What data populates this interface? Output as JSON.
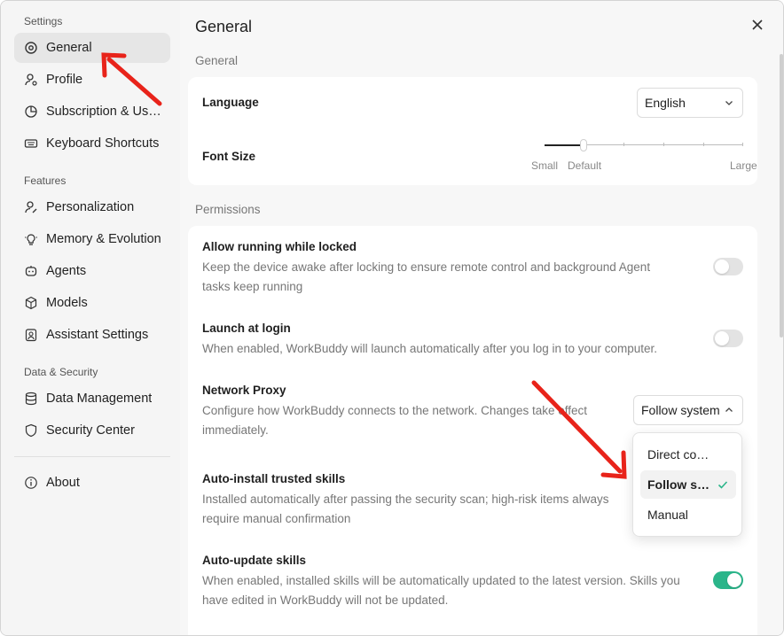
{
  "sidebar": {
    "sections": {
      "settings": "Settings",
      "features": "Features",
      "data_security": "Data & Security"
    },
    "items": [
      {
        "label": "General",
        "icon": "gear-icon"
      },
      {
        "label": "Profile",
        "icon": "user-icon"
      },
      {
        "label": "Subscription & Usage",
        "icon": "pie-chart-icon"
      },
      {
        "label": "Keyboard Shortcuts",
        "icon": "keyboard-icon"
      },
      {
        "label": "Personalization",
        "icon": "user-edit-icon"
      },
      {
        "label": "Memory & Evolution",
        "icon": "lightbulb-icon"
      },
      {
        "label": "Agents",
        "icon": "agent-icon"
      },
      {
        "label": "Models",
        "icon": "cube-icon"
      },
      {
        "label": "Assistant Settings",
        "icon": "assistant-icon"
      },
      {
        "label": "Data Management",
        "icon": "database-icon"
      },
      {
        "label": "Security Center",
        "icon": "shield-icon"
      },
      {
        "label": "About",
        "icon": "info-icon"
      }
    ]
  },
  "main": {
    "title": "General",
    "general_label": "General",
    "language": {
      "title": "Language",
      "value": "English"
    },
    "font_size": {
      "title": "Font Size",
      "labels": [
        "Small",
        "Default",
        "Large"
      ],
      "level": "Default",
      "steps": 6
    },
    "permissions_label": "Permissions",
    "allow_locked": {
      "title": "Allow running while locked",
      "desc": "Keep the device awake after locking to ensure remote control and background Agent tasks keep running",
      "on": false
    },
    "launch_login": {
      "title": "Launch at login",
      "desc": "When enabled, WorkBuddy will launch automatically after you log in to your computer.",
      "on": false
    },
    "network_proxy": {
      "title": "Network Proxy",
      "desc": "Configure how WorkBuddy connects to the network. Changes take effect immediately.",
      "value": "Follow system",
      "options": [
        "Direct connection",
        "Follow system",
        "Manual"
      ]
    },
    "auto_install": {
      "title": "Auto-install trusted skills",
      "desc": "Installed automatically after passing the security scan; high-risk items always require manual confirmation"
    },
    "auto_update": {
      "title": "Auto-update skills",
      "desc": "When enabled, installed skills will be automatically updated to the latest version. Skills you have edited in WorkBuddy will not be updated.",
      "on": true
    }
  },
  "colors": {
    "accent": "#2bb58a",
    "annotation_arrow": "#e8231a"
  }
}
